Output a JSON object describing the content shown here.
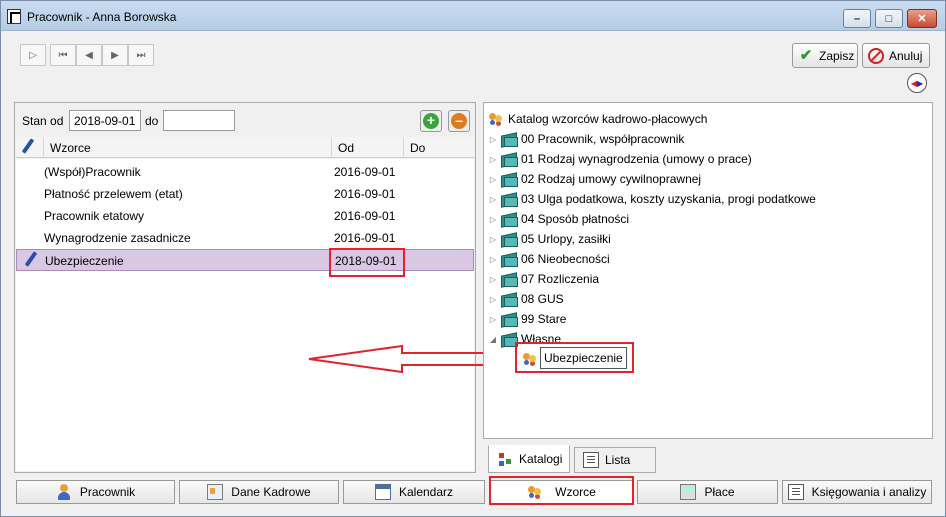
{
  "window": {
    "title": "Pracownik - Anna Borowska"
  },
  "toolbar": {
    "save_label": "Zapisz",
    "cancel_label": "Anuluj"
  },
  "filter": {
    "from_label": "Stan od",
    "from_value": "2018-09-01",
    "to_label": "do",
    "to_value": ""
  },
  "grid": {
    "columns": [
      "Wzorce",
      "Od",
      "Do"
    ],
    "rows": [
      {
        "name": "(Współ)Pracownik",
        "from": "2016-09-01",
        "to": ""
      },
      {
        "name": "Płatność przelewem (etat)",
        "from": "2016-09-01",
        "to": ""
      },
      {
        "name": "Pracownik etatowy",
        "from": "2016-09-01",
        "to": ""
      },
      {
        "name": "Wynagrodzenie zasadnicze",
        "from": "2016-09-01",
        "to": ""
      },
      {
        "name": "Ubezpieczenie",
        "from": "2018-09-01",
        "to": ""
      }
    ]
  },
  "tree": {
    "root": "Katalog wzorców kadrowo-płacowych",
    "items": [
      "00 Pracownik, współpracownik",
      "01 Rodzaj wynagrodzenia (umowy o prace)",
      "02 Rodzaj umowy cywilnoprawnej",
      "03 Ulga podatkowa, koszty uzyskania, progi podatkowe",
      "04 Sposób płatności",
      "05 Urlopy, zasiłki",
      "06 Nieobecności",
      "07 Rozliczenia",
      "08 GUS",
      "99 Stare",
      "Własne"
    ],
    "child": "Ubezpieczenie"
  },
  "right_tabs": [
    "Katalogi",
    "Lista"
  ],
  "bottom_tabs": [
    "Pracownik",
    "Dane Kadrowe",
    "Kalendarz",
    "Wzorce",
    "Płace",
    "Księgowania i analizy"
  ]
}
